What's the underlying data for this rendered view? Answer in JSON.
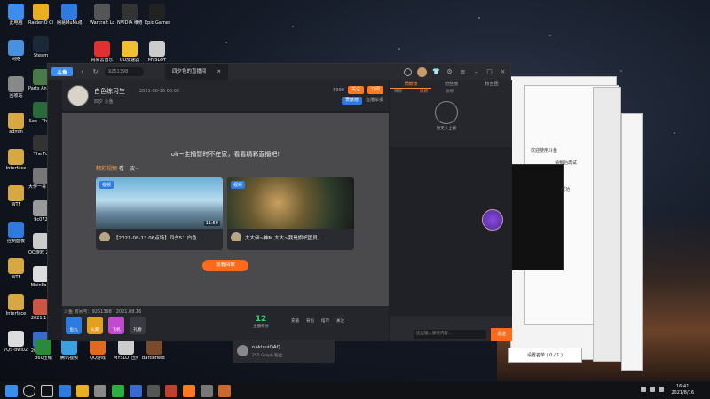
{
  "desktop": {
    "icons": [
      {
        "label": "此电脑",
        "color": "#3a8ef0"
      },
      {
        "label": "RaiderIO Client",
        "color": "#e8b020"
      },
      {
        "label": "网易MuMu模拟器",
        "color": "#2e7be0"
      },
      {
        "label": "Warcraft Logs Up...",
        "color": "#555"
      },
      {
        "label": "NVIDIA 维修",
        "color": "#333"
      },
      {
        "label": "Epic Games Launcher",
        "color": "#222"
      },
      {
        "label": "网络",
        "color": "#4a90e0"
      },
      {
        "label": "Steam",
        "color": "#1b2838"
      },
      {
        "label": "网易云音乐",
        "color": "#e03030"
      },
      {
        "label": "UU加速器",
        "color": "#f0c030"
      },
      {
        "label": "MYSLOT",
        "color": "#ccc"
      },
      {
        "label": "回收站",
        "color": "#888"
      },
      {
        "label": "admin",
        "color": "#d8a840"
      },
      {
        "label": "Interface",
        "color": "#d8a840"
      },
      {
        "label": "WTF",
        "color": "#d8a840"
      },
      {
        "label": "控制面板",
        "color": "#2e7be0"
      },
      {
        "label": "WTF",
        "color": "#d8a840"
      },
      {
        "label": "Interface",
        "color": "#d8a840"
      },
      {
        "label": "7QS-8wi02...",
        "color": "#ddd"
      },
      {
        "label": "360压缩",
        "color": "#2a8a3a"
      },
      {
        "label": "腾讯视频",
        "color": "#3aa0e0"
      },
      {
        "label": "QQ游戏",
        "color": "#e06a20"
      },
      {
        "label": "MYSLOT压缩包",
        "color": "#ccc"
      },
      {
        "label": "Battlefield 1",
        "color": "#7a4a2a"
      },
      {
        "label": "Parts Anim...",
        "color": "#4a7a4a"
      },
      {
        "label": "See - Theo",
        "color": "#2a6a3a"
      },
      {
        "label": "The Fo",
        "color": "#333"
      },
      {
        "label": "大作一哥 Human",
        "color": "#777"
      },
      {
        "label": "9c072",
        "color": "#999"
      },
      {
        "label": "QQ游戏 20210...",
        "color": "#ccc"
      },
      {
        "label": "MainPa...",
        "color": "#ddd"
      },
      {
        "label": "2021 1...",
        "color": "#c54"
      },
      {
        "label": "2021 1...",
        "color": "#3a6ad0"
      }
    ],
    "watermark_channel": "9251398"
  },
  "client": {
    "logo": "斗鱼",
    "search_placeholder": "9251398",
    "tab_label": "四夕色的直播间",
    "room": {
      "title": "白色练习生",
      "meta": "2021-08-16 00:05",
      "sub": "四夕 斗鱼",
      "fans_label": "5990",
      "follow_label": "关注",
      "sub_label": "订阅",
      "rank_label": "贡献榜",
      "report_label": "直播举报"
    },
    "video": {
      "offline_message": "oh~主播暂时不在家，看看精彩直播吧!",
      "recommend_label": "精彩视频",
      "recommend_suffix": "看一波~",
      "cards": [
        {
          "badge": "视频",
          "duration": "11:59",
          "caption": "【2021-08-13 06点场】四夕5：白色..."
        },
        {
          "badge": "视频",
          "duration": "",
          "caption": "大大伊~神M 大大~我是旗帜团员..."
        }
      ],
      "replay_button": "观看回放"
    },
    "bottom": {
      "info": "斗鱼 房间号：9251398 | 2021.08.16",
      "gifts": [
        "鱼丸",
        "火箭",
        "飞机",
        "礼物"
      ],
      "score": "12",
      "score_label": "主播积分",
      "actions": [
        "充值",
        "背包",
        "炫币",
        "关注"
      ]
    },
    "side": {
      "tabs": [
        "贡献榜",
        "粉丝榜",
        "粉丝团"
      ],
      "subtabs": [
        "日榜",
        "周榜",
        "总榜"
      ],
      "guardian_label": "暂无人上榜",
      "input_placeholder": "这里输入聊天内容...",
      "send_label": "发送"
    }
  },
  "notification": {
    "name": "nakisuiQAQ",
    "detail": "255 Graph 粉丝"
  },
  "background_windows": {
    "dialog_text_1": "欢迎使用斗鱼",
    "dialog_text_2": "请稍后再试",
    "dialog_text_3": "成功",
    "dialog_button": "设置名单 ( 0 / 1 )"
  },
  "taskbar": {
    "time": "16:41",
    "date": "2021/8/16"
  }
}
